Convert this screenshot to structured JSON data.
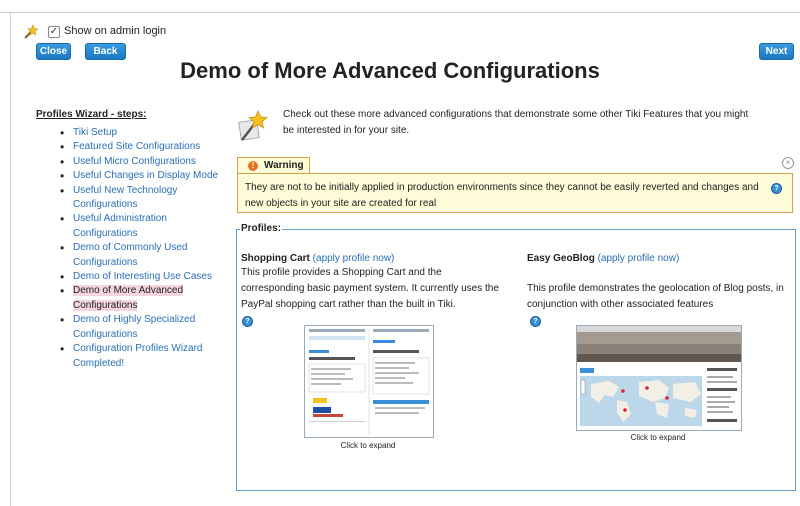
{
  "top": {
    "show_on_admin_login": "Show on admin login",
    "close_label": "Close",
    "back_label": "Back",
    "next_label": "Next"
  },
  "page_title": "Demo of More Advanced Configurations",
  "steps": {
    "heading": "Profiles Wizard - steps:",
    "items": [
      "Tiki Setup",
      "Featured Site Configurations",
      "Useful Micro Configurations",
      "Useful Changes in Display Mode",
      "Useful New Technology Configurations",
      "Useful Administration Configurations",
      "Demo of Commonly Used Configurations",
      "Demo of Interesting Use Cases",
      "Demo of More Advanced Configurations",
      "Demo of Highly Specialized Configurations",
      "Configuration Profiles Wizard Completed!"
    ],
    "current_index": 8
  },
  "intro": "Check out these more advanced configurations that demonstrate some other Tiki Features that you might be interested in for your site.",
  "warning": {
    "title": "Warning",
    "text": "They are not to be initially applied in production environments since they cannot be easily reverted and changes and new objects in your site are created for real"
  },
  "profiles": {
    "legend": "Profiles:",
    "shopping": {
      "name": "Shopping Cart",
      "apply": "(apply profile now)",
      "description": "This profile provides a Shopping Cart and the corresponding basic payment system. It currently uses the PayPal shopping cart rather than the built in Tiki.",
      "caption": "Click to expand"
    },
    "geoblog": {
      "name": "Easy GeoBlog",
      "apply": "(apply profile now)",
      "description": "This profile demonstrates the geolocation of Blog posts, in conjunction with other associated features",
      "caption": "Click to expand"
    }
  },
  "colors": {
    "button": "#1a78c2",
    "link": "#2a6fb5",
    "warning_bg": "#fdfbd8",
    "warning_border": "#d8a24a",
    "current_step_bg": "#f5d5dd"
  },
  "icons": {
    "wizard": "magic-wand-icon",
    "warning": "warning-icon",
    "help": "help-icon",
    "close": "close-icon"
  }
}
